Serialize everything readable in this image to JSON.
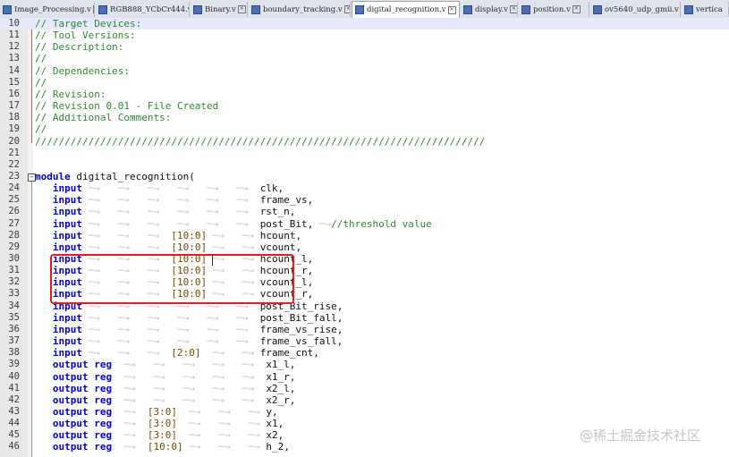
{
  "tabs": [
    {
      "label": "Image_Processing.v",
      "active": false
    },
    {
      "label": "RGB888_YCbCr444.v",
      "active": false
    },
    {
      "label": "Binary.v",
      "active": false
    },
    {
      "label": "boundary_tracking.v",
      "active": false
    },
    {
      "label": "digital_recognition.v",
      "active": true
    },
    {
      "label": "display.v",
      "active": false
    },
    {
      "label": "position.v",
      "active": false
    },
    {
      "label": "ov5640_udp_gmii.v",
      "active": false
    },
    {
      "label": "vertica",
      "active": false
    }
  ],
  "editor": {
    "highlighted_line": "10",
    "lines": [
      {
        "n": "10",
        "tokens": [
          {
            "t": "// Target Devices:",
            "c": "cmt"
          }
        ]
      },
      {
        "n": "11",
        "tokens": [
          {
            "t": "// Tool Versions:",
            "c": "cmt"
          }
        ]
      },
      {
        "n": "12",
        "tokens": [
          {
            "t": "// Description:",
            "c": "cmt"
          }
        ]
      },
      {
        "n": "13",
        "tokens": [
          {
            "t": "//",
            "c": "cmt"
          }
        ]
      },
      {
        "n": "14",
        "tokens": [
          {
            "t": "// Dependencies:",
            "c": "cmt"
          }
        ]
      },
      {
        "n": "15",
        "tokens": [
          {
            "t": "//",
            "c": "cmt"
          }
        ]
      },
      {
        "n": "16",
        "tokens": [
          {
            "t": "// Revision:",
            "c": "cmt"
          }
        ]
      },
      {
        "n": "17",
        "tokens": [
          {
            "t": "// Revision 0.01 - File Created",
            "c": "cmt"
          }
        ]
      },
      {
        "n": "18",
        "tokens": [
          {
            "t": "// Additional Comments:",
            "c": "cmt"
          }
        ]
      },
      {
        "n": "19",
        "tokens": [
          {
            "t": "//",
            "c": "cmt"
          }
        ]
      },
      {
        "n": "20",
        "tokens": [
          {
            "t": "////////////////////////////////////////////////////////////////////////////",
            "c": "cmt"
          }
        ]
      },
      {
        "n": "21",
        "tokens": []
      },
      {
        "n": "22",
        "tokens": []
      },
      {
        "n": "23",
        "tokens": [
          {
            "t": "module",
            "c": "kw"
          },
          {
            "t": " digital_recognition(",
            "c": "id"
          }
        ]
      },
      {
        "n": "24",
        "tokens": [
          {
            "t": "   ",
            "c": "ar"
          },
          {
            "t": "input",
            "c": "kw"
          },
          {
            "t": " ─→   ─→   ─→   ─→   ─→   ─→  ",
            "c": "ar"
          },
          {
            "t": "clk,",
            "c": "id"
          }
        ]
      },
      {
        "n": "25",
        "tokens": [
          {
            "t": "   ",
            "c": "ar"
          },
          {
            "t": "input",
            "c": "kw"
          },
          {
            "t": " ─→   ─→   ─→   ─→   ─→   ─→  ",
            "c": "ar"
          },
          {
            "t": "frame_vs,",
            "c": "id"
          }
        ]
      },
      {
        "n": "26",
        "tokens": [
          {
            "t": "   ",
            "c": "ar"
          },
          {
            "t": "input",
            "c": "kw"
          },
          {
            "t": " ─→   ─→   ─→   ─→   ─→   ─→  ",
            "c": "ar"
          },
          {
            "t": "rst_n,",
            "c": "id"
          }
        ]
      },
      {
        "n": "27",
        "tokens": [
          {
            "t": "   ",
            "c": "ar"
          },
          {
            "t": "input",
            "c": "kw"
          },
          {
            "t": " ─→   ─→   ─→   ─→   ─→   ─→  ",
            "c": "ar"
          },
          {
            "t": "post_Bit,",
            "c": "id"
          },
          {
            "t": " ─→",
            "c": "ar"
          },
          {
            "t": "//threshold value",
            "c": "cmt"
          }
        ]
      },
      {
        "n": "28",
        "tokens": [
          {
            "t": "   ",
            "c": "ar"
          },
          {
            "t": "input",
            "c": "kw"
          },
          {
            "t": " ─→   ─→   ─→  ",
            "c": "ar"
          },
          {
            "t": "[10:0]",
            "c": "br"
          },
          {
            "t": " ─→   ─→ ",
            "c": "ar"
          },
          {
            "t": "hcount,",
            "c": "id"
          }
        ]
      },
      {
        "n": "29",
        "tokens": [
          {
            "t": "   ",
            "c": "ar"
          },
          {
            "t": "input",
            "c": "kw"
          },
          {
            "t": " ─→   ─→   ─→  ",
            "c": "ar"
          },
          {
            "t": "[10:0]",
            "c": "br"
          },
          {
            "t": " ─→   ─→ ",
            "c": "ar"
          },
          {
            "t": "vcount,",
            "c": "id"
          }
        ]
      },
      {
        "n": "30",
        "tokens": [
          {
            "t": "   ",
            "c": "ar"
          },
          {
            "t": "input",
            "c": "kw"
          },
          {
            "t": " ─→   ─→   ─→  ",
            "c": "ar"
          },
          {
            "t": "[10:0]",
            "c": "br"
          },
          {
            "t": " ─→   ─→ ",
            "c": "ar"
          },
          {
            "t": "hcount_l,",
            "c": "id"
          }
        ]
      },
      {
        "n": "31",
        "tokens": [
          {
            "t": "   ",
            "c": "ar"
          },
          {
            "t": "input",
            "c": "kw"
          },
          {
            "t": " ─→   ─→   ─→  ",
            "c": "ar"
          },
          {
            "t": "[10:0]",
            "c": "br"
          },
          {
            "t": " ─→   ─→ ",
            "c": "ar"
          },
          {
            "t": "hcount_r,",
            "c": "id"
          }
        ]
      },
      {
        "n": "32",
        "tokens": [
          {
            "t": "   ",
            "c": "ar"
          },
          {
            "t": "input",
            "c": "kw"
          },
          {
            "t": " ─→   ─→   ─→  ",
            "c": "ar"
          },
          {
            "t": "[10:0]",
            "c": "br"
          },
          {
            "t": " ─→   ─→ ",
            "c": "ar"
          },
          {
            "t": "vcount_l,",
            "c": "id"
          }
        ]
      },
      {
        "n": "33",
        "tokens": [
          {
            "t": "   ",
            "c": "ar"
          },
          {
            "t": "input",
            "c": "kw"
          },
          {
            "t": " ─→   ─→   ─→  ",
            "c": "ar"
          },
          {
            "t": "[10:0]",
            "c": "br"
          },
          {
            "t": " ─→   ─→ ",
            "c": "ar"
          },
          {
            "t": "vcount_r,",
            "c": "id"
          }
        ]
      },
      {
        "n": "34",
        "tokens": [
          {
            "t": "   ",
            "c": "ar"
          },
          {
            "t": "input",
            "c": "kw"
          },
          {
            "t": " ─→   ─→   ─→   ─→   ─→   ─→  ",
            "c": "ar"
          },
          {
            "t": "post_Bit_rise,",
            "c": "id"
          }
        ]
      },
      {
        "n": "35",
        "tokens": [
          {
            "t": "   ",
            "c": "ar"
          },
          {
            "t": "input",
            "c": "kw"
          },
          {
            "t": " ─→   ─→   ─→   ─→   ─→   ─→  ",
            "c": "ar"
          },
          {
            "t": "post_Bit_fall,",
            "c": "id"
          }
        ]
      },
      {
        "n": "36",
        "tokens": [
          {
            "t": "   ",
            "c": "ar"
          },
          {
            "t": "input",
            "c": "kw"
          },
          {
            "t": " ─→   ─→   ─→   ─→   ─→   ─→  ",
            "c": "ar"
          },
          {
            "t": "frame_vs_rise,",
            "c": "id"
          }
        ]
      },
      {
        "n": "37",
        "tokens": [
          {
            "t": "   ",
            "c": "ar"
          },
          {
            "t": "input",
            "c": "kw"
          },
          {
            "t": " ─→   ─→   ─→   ─→   ─→   ─→  ",
            "c": "ar"
          },
          {
            "t": "frame_vs_fall,",
            "c": "id"
          }
        ]
      },
      {
        "n": "38",
        "tokens": [
          {
            "t": "   ",
            "c": "ar"
          },
          {
            "t": "input",
            "c": "kw"
          },
          {
            "t": " ─→   ─→   ─→  ",
            "c": "ar"
          },
          {
            "t": "[2:0]",
            "c": "br"
          },
          {
            "t": "  ─→   ─→ ",
            "c": "ar"
          },
          {
            "t": "frame_cnt,",
            "c": "id"
          }
        ]
      },
      {
        "n": "39",
        "tokens": [
          {
            "t": "   ",
            "c": "ar"
          },
          {
            "t": "output",
            "c": "kw"
          },
          {
            "t": " ",
            "c": "ar"
          },
          {
            "t": "reg",
            "c": "kw"
          },
          {
            "t": "  ─→   ─→   ─→   ─→   ─→  ",
            "c": "ar"
          },
          {
            "t": "x1_l,",
            "c": "id"
          }
        ]
      },
      {
        "n": "40",
        "tokens": [
          {
            "t": "   ",
            "c": "ar"
          },
          {
            "t": "output",
            "c": "kw"
          },
          {
            "t": " ",
            "c": "ar"
          },
          {
            "t": "reg",
            "c": "kw"
          },
          {
            "t": "  ─→   ─→   ─→   ─→   ─→  ",
            "c": "ar"
          },
          {
            "t": "x1_r,",
            "c": "id"
          }
        ]
      },
      {
        "n": "41",
        "tokens": [
          {
            "t": "   ",
            "c": "ar"
          },
          {
            "t": "output",
            "c": "kw"
          },
          {
            "t": " ",
            "c": "ar"
          },
          {
            "t": "reg",
            "c": "kw"
          },
          {
            "t": "  ─→   ─→   ─→   ─→   ─→  ",
            "c": "ar"
          },
          {
            "t": "x2_l,",
            "c": "id"
          }
        ]
      },
      {
        "n": "42",
        "tokens": [
          {
            "t": "   ",
            "c": "ar"
          },
          {
            "t": "output",
            "c": "kw"
          },
          {
            "t": " ",
            "c": "ar"
          },
          {
            "t": "reg",
            "c": "kw"
          },
          {
            "t": "  ─→   ─→   ─→   ─→   ─→  ",
            "c": "ar"
          },
          {
            "t": "x2_r,",
            "c": "id"
          }
        ]
      },
      {
        "n": "43",
        "tokens": [
          {
            "t": "   ",
            "c": "ar"
          },
          {
            "t": "output",
            "c": "kw"
          },
          {
            "t": " ",
            "c": "ar"
          },
          {
            "t": "reg",
            "c": "kw"
          },
          {
            "t": "  ─→  ",
            "c": "ar"
          },
          {
            "t": "[3:0]",
            "c": "br"
          },
          {
            "t": "  ─→   ─→   ─→ ",
            "c": "ar"
          },
          {
            "t": "y,",
            "c": "id"
          }
        ]
      },
      {
        "n": "44",
        "tokens": [
          {
            "t": "   ",
            "c": "ar"
          },
          {
            "t": "output",
            "c": "kw"
          },
          {
            "t": " ",
            "c": "ar"
          },
          {
            "t": "reg",
            "c": "kw"
          },
          {
            "t": "  ─→  ",
            "c": "ar"
          },
          {
            "t": "[3:0]",
            "c": "br"
          },
          {
            "t": "  ─→   ─→   ─→ ",
            "c": "ar"
          },
          {
            "t": "x1,",
            "c": "id"
          }
        ]
      },
      {
        "n": "45",
        "tokens": [
          {
            "t": "   ",
            "c": "ar"
          },
          {
            "t": "output",
            "c": "kw"
          },
          {
            "t": " ",
            "c": "ar"
          },
          {
            "t": "reg",
            "c": "kw"
          },
          {
            "t": "  ─→  ",
            "c": "ar"
          },
          {
            "t": "[3:0]",
            "c": "br"
          },
          {
            "t": "  ─→   ─→   ─→ ",
            "c": "ar"
          },
          {
            "t": "x2,",
            "c": "id"
          }
        ]
      },
      {
        "n": "46",
        "tokens": [
          {
            "t": "   ",
            "c": "ar"
          },
          {
            "t": "output",
            "c": "kw"
          },
          {
            "t": " ",
            "c": "ar"
          },
          {
            "t": "reg",
            "c": "kw"
          },
          {
            "t": "  ─→  ",
            "c": "ar"
          },
          {
            "t": "[10:0]",
            "c": "br"
          },
          {
            "t": " ─→   ─→   ─→ ",
            "c": "ar"
          },
          {
            "t": "h_2,",
            "c": "id"
          }
        ]
      }
    ]
  },
  "annotation": {
    "color": "#e81c1c",
    "from_line": "30",
    "to_line": "33"
  },
  "watermark": "@稀土掘金技术社区",
  "colors": {
    "comment": "#2e8b2e",
    "keyword": "#0000e0",
    "bracket": "#7a4a00",
    "tab_icon": "#4a6fb5"
  }
}
